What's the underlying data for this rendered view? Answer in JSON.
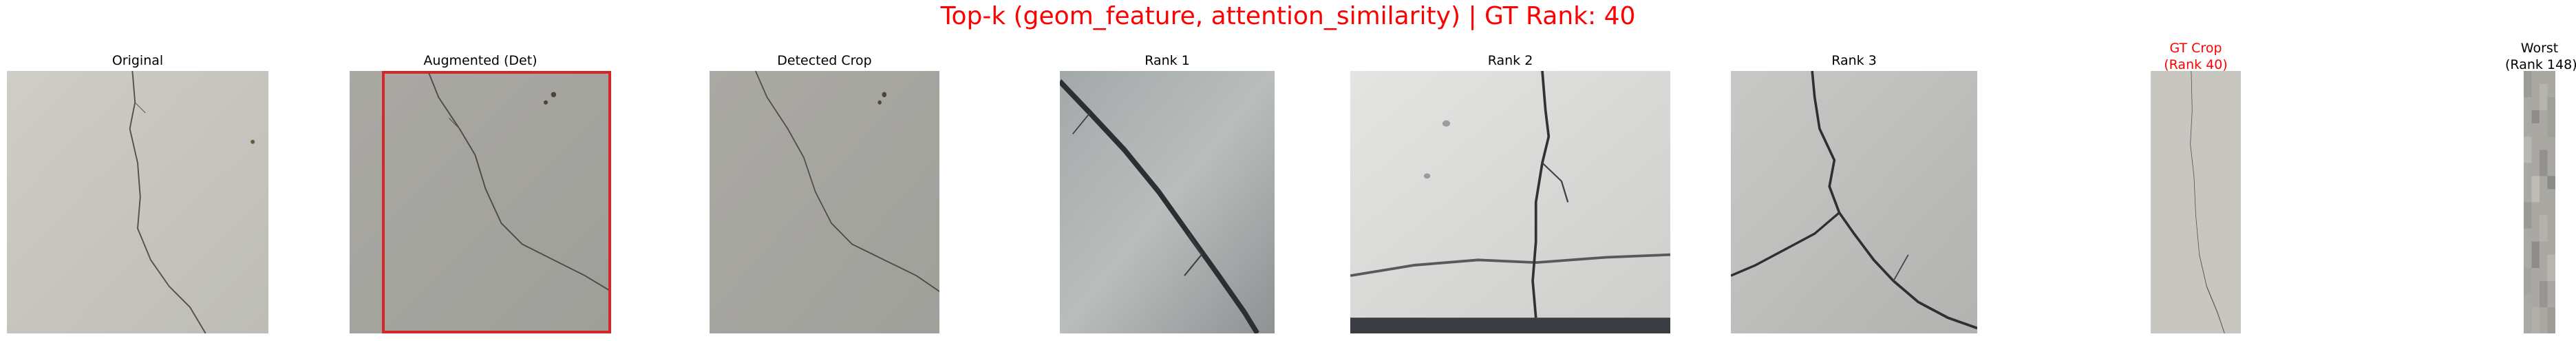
{
  "figure": {
    "suptitle": "Top-k (geom_feature, attention_similarity) | GT Rank: 40",
    "title_color": "#ff0000",
    "panels": [
      {
        "id": "original",
        "title_lines": [
          "Original"
        ],
        "color": "#000000"
      },
      {
        "id": "augmented",
        "title_lines": [
          "Augmented (Det)"
        ],
        "color": "#000000",
        "box_color": "#d62728"
      },
      {
        "id": "detected",
        "title_lines": [
          "Detected Crop"
        ],
        "color": "#000000"
      },
      {
        "id": "rank1",
        "title_lines": [
          "Rank 1"
        ],
        "color": "#000000"
      },
      {
        "id": "rank2",
        "title_lines": [
          "Rank 2"
        ],
        "color": "#000000"
      },
      {
        "id": "rank3",
        "title_lines": [
          "Rank 3"
        ],
        "color": "#000000"
      },
      {
        "id": "gt",
        "title_lines": [
          "GT Crop",
          "(Rank 40)"
        ],
        "color": "#ff0000"
      },
      {
        "id": "worst",
        "title_lines": [
          "Worst",
          "(Rank 148)"
        ],
        "color": "#000000"
      }
    ]
  }
}
